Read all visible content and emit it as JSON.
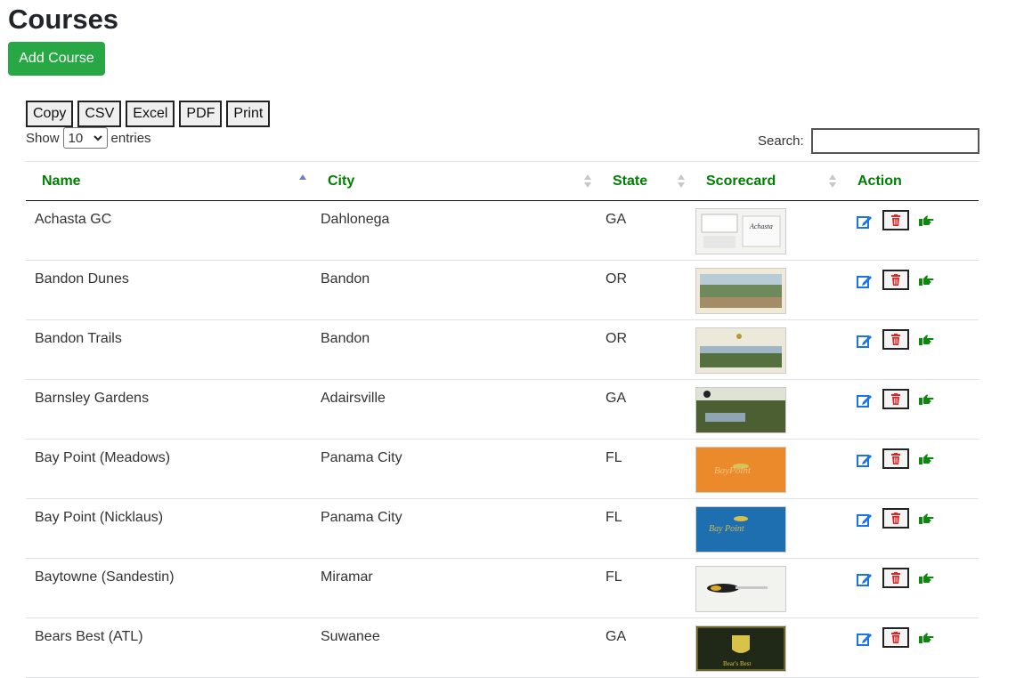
{
  "page": {
    "title": "Courses",
    "add_button": "Add Course"
  },
  "export_buttons": [
    "Copy",
    "CSV",
    "Excel",
    "PDF",
    "Print"
  ],
  "length": {
    "show": "Show",
    "value": "10",
    "entries": "entries"
  },
  "search": {
    "label": "Search:",
    "value": ""
  },
  "table": {
    "columns": [
      "Name",
      "City",
      "State",
      "Scorecard",
      "Action"
    ],
    "sort_column": "Name",
    "sort_direction": "ascending",
    "rows": [
      {
        "name": "Achasta GC",
        "city": "Dahlonega",
        "state": "GA",
        "scorecard": "achasta-scorecard"
      },
      {
        "name": "Bandon Dunes",
        "city": "Bandon",
        "state": "OR",
        "scorecard": "bandon-dunes-scorecard"
      },
      {
        "name": "Bandon Trails",
        "city": "Bandon",
        "state": "OR",
        "scorecard": "bandon-trails-scorecard"
      },
      {
        "name": "Barnsley Gardens",
        "city": "Adairsville",
        "state": "GA",
        "scorecard": "barnsley-scorecard"
      },
      {
        "name": "Bay Point (Meadows)",
        "city": "Panama City",
        "state": "FL",
        "scorecard": "bay-point-meadows-scorecard"
      },
      {
        "name": "Bay Point (Nicklaus)",
        "city": "Panama City",
        "state": "FL",
        "scorecard": "bay-point-nicklaus-scorecard"
      },
      {
        "name": "Baytowne (Sandestin)",
        "city": "Miramar",
        "state": "FL",
        "scorecard": "baytowne-scorecard"
      },
      {
        "name": "Bears Best (ATL)",
        "city": "Suwanee",
        "state": "GA",
        "scorecard": "bears-best-scorecard"
      }
    ]
  },
  "icons": {
    "edit": "edit-icon",
    "delete": "trash-icon",
    "view": "pointing-hand-icon"
  },
  "colors": {
    "accent_green": "#28a745",
    "header_green": "#008000",
    "edit_blue": "#1a73e8",
    "delete_red": "#e02424",
    "view_green": "#0a8a0a"
  }
}
